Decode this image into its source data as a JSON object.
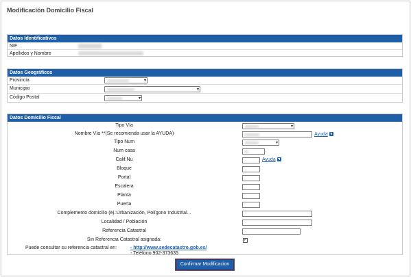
{
  "page": {
    "title": "Modificación Domicilio Fiscal"
  },
  "identificativos": {
    "header": "Datos Identificativos",
    "nif_label": "NIF",
    "nombre_label": "Apellidos y Nombre"
  },
  "geograficos": {
    "header": "Datos Geográficos",
    "provincia_label": "Provincia",
    "municipio_label": "Municipio",
    "cp_label": "Código Postal"
  },
  "domicilio": {
    "header": "Datos Domicilio Fiscal",
    "tipo_via_label": "Tipo Vía",
    "nombre_via_label": "Nombre Vía **(Se recomienda usar la AYUDA)",
    "tipo_num_label": "Tipo Num",
    "num_casa_label": "Num casa",
    "calif_label": "Calif.Nu",
    "bloque_label": "Bloque",
    "portal_label": "Portal",
    "escalera_label": "Escalera",
    "planta_label": "Planta",
    "puerta_label": "Puerta",
    "complemento_label": "Complemento domicilio (ej.:Urbanización, Polígono Industrial...",
    "localidad_label": "Localidad / Población",
    "ref_catastral_label": "Referencia Catastral",
    "sin_ref_label": "Sin Referencia Catastral asignada:",
    "sin_ref_checked": true,
    "ayuda_label": "Ayuda",
    "consultar_label": "Puede consultar su referencia catastral en:",
    "catastro_link": "- http://www.sedecatastro.gob.es/",
    "telefono": "- Teléfono 902-373635"
  },
  "actions": {
    "confirm_label": "Confirmar Modificacion"
  },
  "colors": {
    "accent": "#1f5fa8",
    "button_border": "#8b1a1a"
  }
}
